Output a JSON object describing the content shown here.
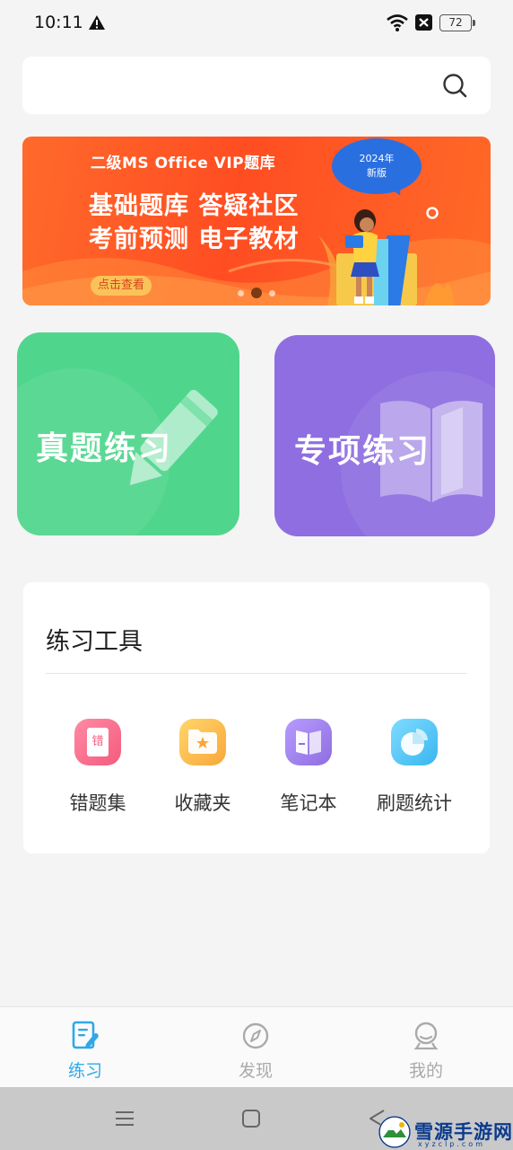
{
  "status_bar": {
    "time": "10:11",
    "battery": "72"
  },
  "search": {
    "placeholder": ""
  },
  "banner": {
    "title": "二级MS  Office  VIP题库",
    "line1": "基础题库  答疑社区",
    "line2": "考前预测  电子教材",
    "badge_year": "2024年",
    "badge_label": "新版",
    "button": "点击查看",
    "slide_count": 3,
    "active_slide": 2
  },
  "cards": {
    "real_exam": "真题练习",
    "topic_practice": "专项练习"
  },
  "tools": {
    "title": "练习工具",
    "items": [
      {
        "label": "错题集",
        "icon": "mistakes-book-icon",
        "glyph": "错"
      },
      {
        "label": "收藏夹",
        "icon": "favorites-folder-icon"
      },
      {
        "label": "笔记本",
        "icon": "notebook-icon"
      },
      {
        "label": "刷题统计",
        "icon": "statistics-pie-icon"
      }
    ]
  },
  "bottom_nav": {
    "items": [
      {
        "label": "练习",
        "icon": "practice-icon",
        "active": true
      },
      {
        "label": "发现",
        "icon": "compass-icon",
        "active": false
      },
      {
        "label": "我的",
        "icon": "profile-icon",
        "active": false
      }
    ]
  },
  "watermark": {
    "text": "雪源手游网",
    "sub": "xyzclp.com"
  },
  "colors": {
    "accent": "#2fa8e8",
    "inactive": "#aaaaaa",
    "real_card": "#4fd68c",
    "topic_card": "#8e6ee0",
    "banner": "#ff5a26"
  }
}
